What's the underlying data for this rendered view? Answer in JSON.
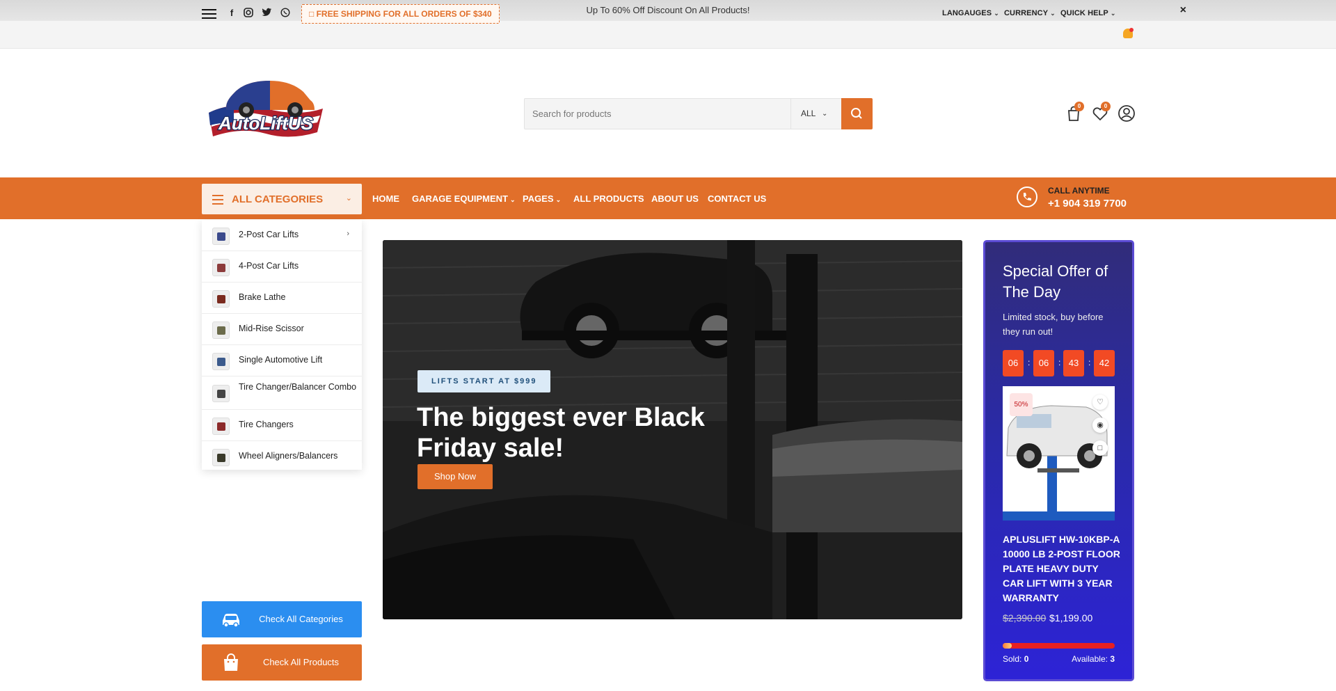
{
  "promo": {
    "text": "Up To 60% Off Discount On All Products!",
    "close": "×"
  },
  "utility": {
    "shipping": "FREE SHIPPING FOR ALL ORDERS OF $340",
    "menus": [
      "LANGAUGES",
      "CURRENCY",
      "QUICK HELP"
    ],
    "social_icons": [
      "facebook-icon",
      "instagram-icon",
      "twitter-icon",
      "whatsapp-icon"
    ]
  },
  "header": {
    "logo_text": "AutoLiftUS",
    "search": {
      "placeholder": "Search for products",
      "category": "ALL"
    },
    "cart_count": "0",
    "wishlist_count": "0"
  },
  "nav": {
    "categories_label": "ALL CATEGORIES",
    "items": [
      "HOME",
      "GARAGE EQUIPMENT",
      "PAGES",
      "ALL PRODUCTS",
      "ABOUT US",
      "CONTACT US"
    ],
    "call_label": "CALL ANYTIME",
    "call_number": "+1 904 319 7700"
  },
  "categories": [
    {
      "label": "2-Post Car Lifts",
      "color": "#3b4a8c"
    },
    {
      "label": "4-Post Car Lifts",
      "color": "#8c3b3b"
    },
    {
      "label": "Brake Lathe",
      "color": "#7a2a1e"
    },
    {
      "label": "Mid-Rise Scissor",
      "color": "#6b6b4b"
    },
    {
      "label": "Single Automotive Lift",
      "color": "#3b5a8c"
    },
    {
      "label": "Tire Changer/Balancer Combo",
      "color": "#444444"
    },
    {
      "label": "Tire Changers",
      "color": "#8c2a2a"
    },
    {
      "label": "Wheel Aligners/Balancers",
      "color": "#3a3a2a"
    }
  ],
  "side_buttons": {
    "categories": "Check All Categories",
    "products": "Check All Products",
    "categories_color": "#2b8ef0",
    "products_color": "#e16f2a"
  },
  "hero": {
    "tag": "LIFTS START AT $999",
    "title": "The biggest ever Black Friday sale!",
    "button": "Shop Now"
  },
  "offer": {
    "title": "Special Offer of The Day",
    "subtitle": "Limited stock, buy before they run out!",
    "countdown": [
      "06",
      "06",
      "43",
      "42"
    ],
    "discount": "50%",
    "product_name": "APLUSLIFT HW-10KBP-A 10000 LB 2-POST FLOOR PLATE HEAVY DUTY CAR LIFT WITH 3 YEAR WARRANTY",
    "price_old": "$2,390.00",
    "price_new": "$1,199.00",
    "sold_label": "Sold:",
    "sold": "0",
    "available_label": "Available:",
    "available": "3",
    "progress": 0.08
  },
  "colors": {
    "accent": "#e16f2a",
    "offer_bg": "#2d23d6",
    "countdown": "#f24a24"
  }
}
